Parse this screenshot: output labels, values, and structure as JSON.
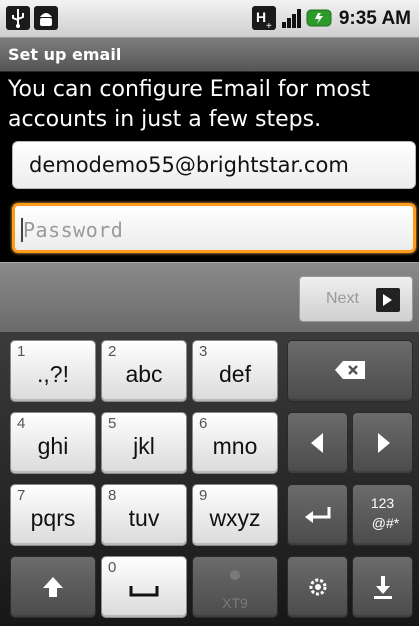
{
  "status_bar": {
    "time": "9:35 AM",
    "icons": [
      "usb-icon",
      "android-icon",
      "hplus-icon",
      "signal-icon",
      "battery-icon"
    ]
  },
  "title": "Set up email",
  "intro_text": "You can configure Email for most accounts in just a few steps.",
  "email": {
    "value": "demodemo55@brightstar.com"
  },
  "password": {
    "placeholder": "Password"
  },
  "next_button": {
    "label": "Next"
  },
  "keyboard": {
    "keys": [
      {
        "num": "1",
        "label": ".,?!"
      },
      {
        "num": "2",
        "label": "abc"
      },
      {
        "num": "3",
        "label": "def"
      },
      {
        "label": ""
      },
      {
        "num": "4",
        "label": "ghi"
      },
      {
        "num": "5",
        "label": "jkl"
      },
      {
        "num": "6",
        "label": "mno"
      },
      {
        "num": "7",
        "label": "pqrs"
      },
      {
        "num": "8",
        "label": "tuv"
      },
      {
        "num": "9",
        "label": "wxyz"
      },
      {
        "label": "123\n@#*"
      },
      {
        "num": "0",
        "label": ""
      }
    ],
    "xt9_label": "XT9",
    "symbols_label_top": "123",
    "symbols_label_bottom": "@#*"
  },
  "colors": {
    "focus_border": "#ff9b1a",
    "background": "#000000",
    "key_light": "#ffffff",
    "key_dark": "#5a5a5a"
  }
}
